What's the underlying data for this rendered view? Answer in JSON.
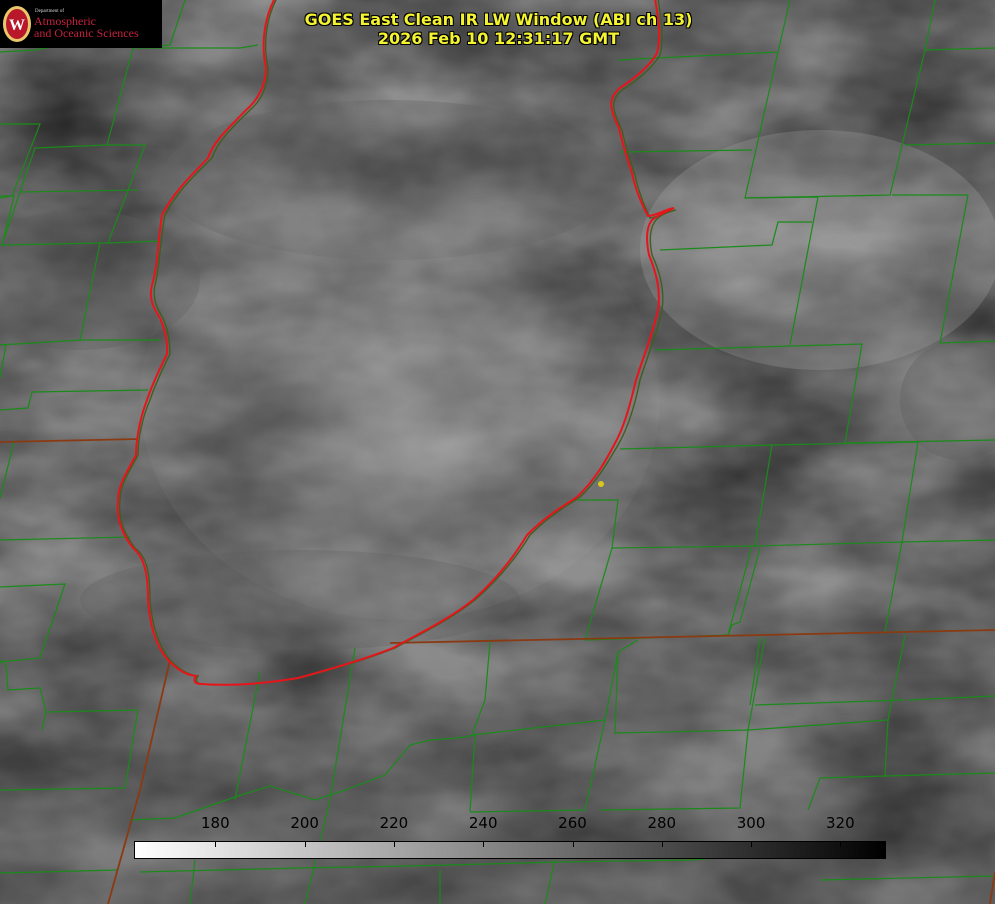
{
  "title": {
    "line1": "GOES East Clean IR LW Window (ABI ch 13)",
    "line2": "2026 Feb 10 12:31:17 GMT"
  },
  "logo": {
    "small_text": "Department of",
    "line1": "Atmospheric",
    "line2": "and Oceanic Sciences",
    "seal_letter": "W"
  },
  "colorbar": {
    "ticks": [
      "180",
      "200",
      "220",
      "240",
      "260",
      "280",
      "300",
      "320"
    ],
    "min": 162,
    "max": 330,
    "scale": "white-to-black"
  },
  "colors": {
    "lake_outline": "#e8141c",
    "county_lines": "#1a8a1a",
    "state_lines": "#8a3a12",
    "title_text": "#f3f331",
    "station_marker": "#d8c81a"
  },
  "map_layers": [
    "lake-michigan-shoreline",
    "county-boundaries",
    "state-boundaries",
    "ir-brightness-temperature"
  ]
}
